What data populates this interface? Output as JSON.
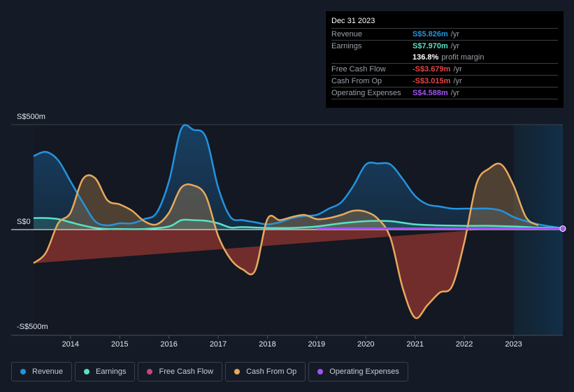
{
  "tooltip": {
    "date": "Dec 31 2023",
    "rows": [
      {
        "name": "Revenue",
        "value": "S$5.826m",
        "unit": "/yr",
        "color": "#2394df"
      },
      {
        "name": "Earnings",
        "value": "S$7.970m",
        "unit": "/yr",
        "color": "#58e1c5"
      },
      {
        "name": "",
        "value": "136.8%",
        "unit": "profit margin",
        "color": "#ffffff"
      },
      {
        "name": "Free Cash Flow",
        "value": "-S$3.679m",
        "unit": "/yr",
        "color": "#e64545"
      },
      {
        "name": "Cash From Op",
        "value": "-S$3.015m",
        "unit": "/yr",
        "color": "#e64545"
      },
      {
        "name": "Operating Expenses",
        "value": "S$4.588m",
        "unit": "/yr",
        "color": "#a154f2"
      }
    ]
  },
  "legend": [
    {
      "label": "Revenue",
      "color": "#2394df"
    },
    {
      "label": "Earnings",
      "color": "#58e1c5"
    },
    {
      "label": "Free Cash Flow",
      "color": "#c4487b"
    },
    {
      "label": "Cash From Op",
      "color": "#e8a95c"
    },
    {
      "label": "Operating Expenses",
      "color": "#a154f2"
    }
  ],
  "chart_data": {
    "type": "area",
    "title": "",
    "xlabel": "",
    "ylabel": "",
    "ylim": [
      -500,
      500
    ],
    "xlim": [
      2013.25,
      2024.0
    ],
    "y_tick_labels": [
      "S$500m",
      "S$0",
      "-S$500m"
    ],
    "y_ticks": [
      500,
      0,
      -500
    ],
    "x_ticks": [
      2014,
      2015,
      2016,
      2017,
      2018,
      2019,
      2020,
      2021,
      2022,
      2023
    ],
    "x_tick_labels": [
      "2014",
      "2015",
      "2016",
      "2017",
      "2018",
      "2019",
      "2020",
      "2021",
      "2022",
      "2023"
    ],
    "forecast_shade_start": 2023.0,
    "legend_position": "bottom",
    "series": [
      {
        "name": "Revenue",
        "color": "#2394df",
        "x": [
          2013.25,
          2013.5,
          2013.75,
          2014.0,
          2014.25,
          2014.5,
          2014.75,
          2015.0,
          2015.25,
          2015.5,
          2015.75,
          2016.0,
          2016.25,
          2016.5,
          2016.75,
          2017.0,
          2017.25,
          2017.5,
          2017.75,
          2018.0,
          2018.25,
          2018.5,
          2018.75,
          2019.0,
          2019.25,
          2019.5,
          2019.75,
          2020.0,
          2020.25,
          2020.5,
          2020.75,
          2021.0,
          2021.25,
          2021.5,
          2021.75,
          2022.0,
          2022.25,
          2022.5,
          2022.75,
          2023.0,
          2023.25,
          2023.5,
          2023.75,
          2024.0
        ],
        "y": [
          350,
          370,
          330,
          230,
          130,
          40,
          20,
          30,
          30,
          50,
          80,
          230,
          480,
          475,
          440,
          200,
          60,
          45,
          35,
          25,
          35,
          55,
          65,
          70,
          100,
          130,
          210,
          310,
          315,
          310,
          240,
          160,
          120,
          110,
          100,
          100,
          100,
          100,
          90,
          60,
          40,
          25,
          15,
          6
        ]
      },
      {
        "name": "Earnings",
        "color": "#58e1c5",
        "x": [
          2013.25,
          2013.5,
          2013.75,
          2014.0,
          2014.25,
          2014.5,
          2014.75,
          2015.0,
          2015.5,
          2016.0,
          2016.25,
          2016.5,
          2016.75,
          2017.0,
          2017.25,
          2017.5,
          2018.0,
          2018.5,
          2019.0,
          2019.5,
          2020.0,
          2020.5,
          2021.0,
          2021.5,
          2022.0,
          2022.5,
          2023.0,
          2023.5,
          2024.0
        ],
        "y": [
          55,
          55,
          50,
          35,
          20,
          8,
          3,
          3,
          3,
          15,
          45,
          45,
          42,
          30,
          10,
          12,
          8,
          8,
          15,
          30,
          40,
          40,
          25,
          20,
          18,
          18,
          15,
          10,
          8
        ]
      },
      {
        "name": "Cash From Op",
        "color": "#e8a95c",
        "x": [
          2013.25,
          2013.5,
          2013.75,
          2014.0,
          2014.25,
          2014.5,
          2014.75,
          2015.0,
          2015.25,
          2015.5,
          2015.75,
          2016.0,
          2016.25,
          2016.5,
          2016.75,
          2017.0,
          2017.25,
          2017.5,
          2017.75,
          2018.0,
          2018.25,
          2018.5,
          2018.75,
          2019.0,
          2019.25,
          2019.5,
          2019.75,
          2020.0,
          2020.25,
          2020.5,
          2020.75,
          2021.0,
          2021.25,
          2021.5,
          2021.75,
          2022.0,
          2022.25,
          2022.5,
          2022.75,
          2023.0,
          2023.25,
          2023.5,
          2023.75,
          2024.0
        ],
        "y": [
          -160,
          -110,
          30,
          80,
          240,
          245,
          140,
          120,
          90,
          40,
          25,
          80,
          200,
          210,
          160,
          -30,
          -140,
          -190,
          -195,
          50,
          45,
          60,
          70,
          50,
          55,
          70,
          90,
          85,
          50,
          -40,
          -280,
          -420,
          -360,
          -300,
          -270,
          -60,
          220,
          290,
          310,
          210,
          60,
          20,
          -3
        ]
      },
      {
        "name": "Free Cash Flow",
        "color": "#c4487b",
        "x": [
          2013.25,
          2024.0
        ],
        "y": [
          -160,
          -3.7
        ]
      },
      {
        "name": "Operating Expenses",
        "color": "#a154f2",
        "x": [
          2019.0,
          2019.5,
          2020.0,
          2021.0,
          2022.0,
          2023.0,
          2024.0
        ],
        "y": [
          5,
          5,
          5,
          5,
          5,
          5,
          4.6
        ]
      }
    ]
  }
}
